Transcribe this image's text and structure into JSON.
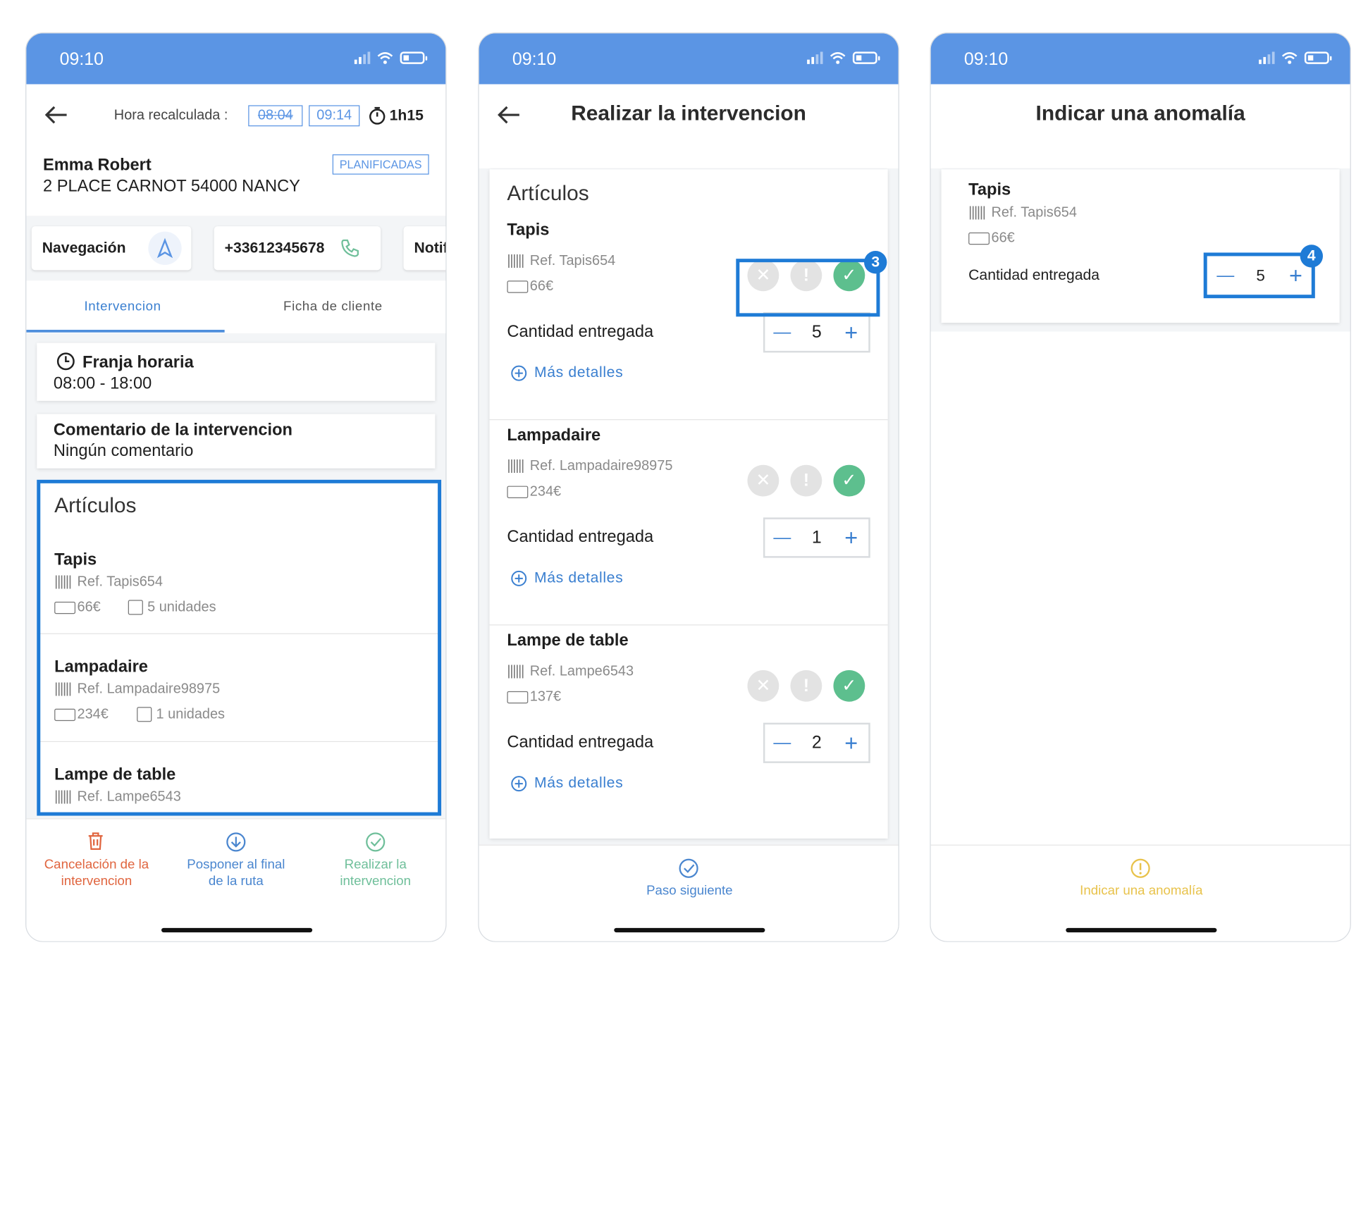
{
  "status": {
    "time": "09:10"
  },
  "screen1": {
    "hora_label": "Hora recalculada :",
    "old_time": "08:04",
    "new_time": "09:14",
    "duration": "1h15",
    "client_name": "Emma Robert",
    "client_address": "2 PLACE CARNOT 54000 NANCY",
    "status_tag": "PLANIFICADAS",
    "actions": {
      "navigation": "Navegación",
      "phone": "+33612345678",
      "notif": "Notif"
    },
    "tabs": {
      "intervencion": "Intervencion",
      "ficha": "Ficha de cliente"
    },
    "franja_title": "Franja horaria",
    "franja_value": "08:00 - 18:00",
    "comment_title": "Comentario de la intervencion",
    "comment_value": "Ningún comentario",
    "articles_title": "Artículos",
    "articles": [
      {
        "name": "Tapis",
        "ref": "Ref. Tapis654",
        "price": "66€",
        "units": "5 unidades"
      },
      {
        "name": "Lampadaire",
        "ref": "Ref. Lampadaire98975",
        "price": "234€",
        "units": "1 unidades"
      },
      {
        "name": "Lampe de table",
        "ref": "Ref. Lampe6543"
      }
    ],
    "bottom": {
      "cancel": [
        "Cancelación de la",
        "intervencion"
      ],
      "postpone": [
        "Posponer al final",
        "de la ruta"
      ],
      "realize": [
        "Realizar la",
        "intervencion"
      ]
    },
    "colors": {
      "cancel": "#e0653f",
      "postpone": "#4a86cf",
      "realize": "#6fbf9a"
    }
  },
  "screen2": {
    "title": "Realizar la intervencion",
    "articles_title": "Artículos",
    "qty_label": "Cantidad entregada",
    "more": "Más detalles",
    "badge": "3",
    "items": [
      {
        "name": "Tapis",
        "ref": "Ref. Tapis654",
        "price": "66€",
        "qty": "5"
      },
      {
        "name": "Lampadaire",
        "ref": "Ref. Lampadaire98975",
        "price": "234€",
        "qty": "1"
      },
      {
        "name": "Lampe de table",
        "ref": "Ref. Lampe6543",
        "price": "137€",
        "qty": "2"
      }
    ],
    "next": "Paso siguiente"
  },
  "screen3": {
    "title": "Indicar una anomalía",
    "item": {
      "name": "Tapis",
      "ref": "Ref. Tapis654",
      "price": "66€",
      "qty_label": "Cantidad entregada",
      "qty": "5"
    },
    "badge": "4",
    "anomaly": "Indicar una anomalía",
    "color": "#e8c24a"
  }
}
